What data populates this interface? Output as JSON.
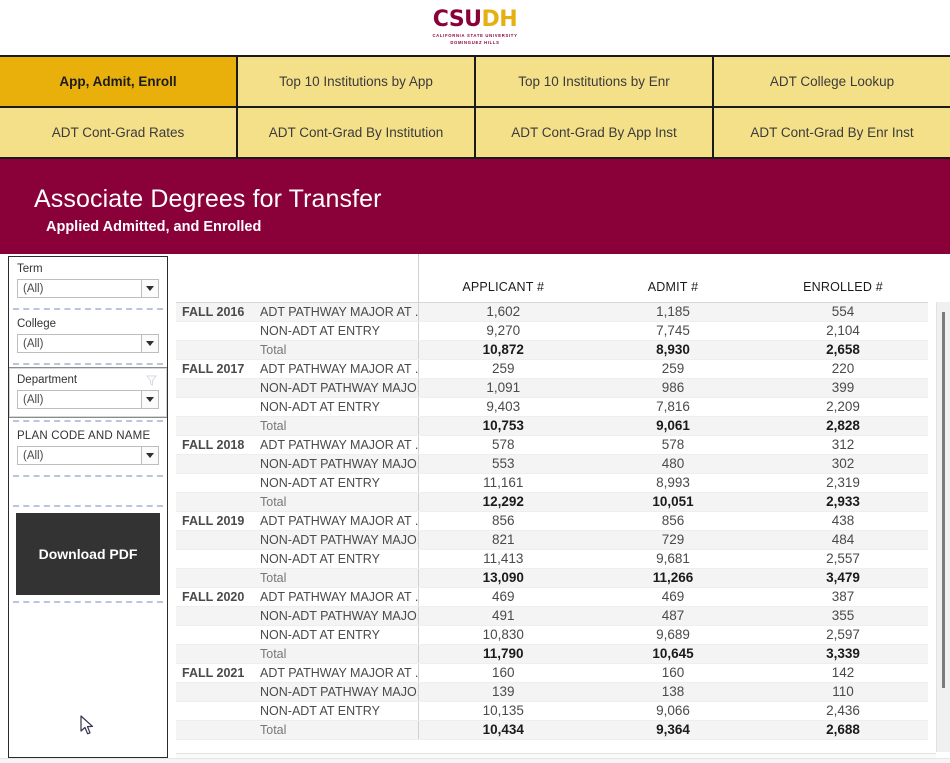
{
  "logo": {
    "mark_csu": "CSU",
    "mark_dh": "DH",
    "sub_line1": "CALIFORNIA STATE UNIVERSITY",
    "sub_line2": "DOMINGUEZ HILLS",
    "color_maroon": "#8A0038",
    "color_gold": "#E6B012"
  },
  "tabs": {
    "row1": [
      {
        "label": "App, Admit, Enroll",
        "active": true
      },
      {
        "label": "Top 10 Institutions by App",
        "active": false
      },
      {
        "label": "Top 10 Institutions by Enr",
        "active": false
      },
      {
        "label": "ADT College Lookup",
        "active": false
      }
    ],
    "row2": [
      {
        "label": "ADT Cont-Grad Rates",
        "active": false
      },
      {
        "label": "ADT Cont-Grad By Institution",
        "active": false
      },
      {
        "label": "ADT Cont-Grad By App Inst",
        "active": false
      },
      {
        "label": "ADT Cont-Grad By Enr Inst",
        "active": false
      }
    ],
    "active_color": "#E9B00C",
    "inactive_color": "#F5E08A"
  },
  "banner": {
    "title": "Associate Degrees for Transfer",
    "subtitle": "Applied Admitted, and Enrolled",
    "background": "#8A0038"
  },
  "sidebar": {
    "filters": [
      {
        "label": "Term",
        "value": "(All)",
        "has_funnel": false,
        "selected": false
      },
      {
        "label": "College",
        "value": "(All)",
        "has_funnel": false,
        "selected": false
      },
      {
        "label": "Department",
        "value": "(All)",
        "has_funnel": true,
        "selected": true
      },
      {
        "label": "PLAN CODE AND NAME",
        "value": "(All)",
        "has_funnel": false,
        "selected": false
      }
    ],
    "download_button": "Download PDF"
  },
  "table": {
    "columns": [
      "",
      "",
      "APPLICANT #",
      "ADMIT #",
      "ENROLLED #"
    ],
    "header_applicant": "APPLICANT #",
    "header_admit": "ADMIT #",
    "header_enrolled": "ENROLLED #",
    "rows": [
      {
        "year": "FALL 2016",
        "category": "ADT PATHWAY MAJOR AT ..",
        "applicant": "1,602",
        "admit": "1,185",
        "enrolled": "554",
        "total": false,
        "group_start": true
      },
      {
        "year": "",
        "category": "NON-ADT AT ENTRY",
        "applicant": "9,270",
        "admit": "7,745",
        "enrolled": "2,104",
        "total": false,
        "group_start": false
      },
      {
        "year": "",
        "category": "Total",
        "applicant": "10,872",
        "admit": "8,930",
        "enrolled": "2,658",
        "total": true,
        "group_start": false
      },
      {
        "year": "FALL 2017",
        "category": "ADT PATHWAY MAJOR AT ..",
        "applicant": "259",
        "admit": "259",
        "enrolled": "220",
        "total": false,
        "group_start": true
      },
      {
        "year": "",
        "category": "NON-ADT PATHWAY MAJO..",
        "applicant": "1,091",
        "admit": "986",
        "enrolled": "399",
        "total": false,
        "group_start": false
      },
      {
        "year": "",
        "category": "NON-ADT AT ENTRY",
        "applicant": "9,403",
        "admit": "7,816",
        "enrolled": "2,209",
        "total": false,
        "group_start": false
      },
      {
        "year": "",
        "category": "Total",
        "applicant": "10,753",
        "admit": "9,061",
        "enrolled": "2,828",
        "total": true,
        "group_start": false
      },
      {
        "year": "FALL 2018",
        "category": "ADT PATHWAY MAJOR AT ..",
        "applicant": "578",
        "admit": "578",
        "enrolled": "312",
        "total": false,
        "group_start": true
      },
      {
        "year": "",
        "category": "NON-ADT PATHWAY MAJO..",
        "applicant": "553",
        "admit": "480",
        "enrolled": "302",
        "total": false,
        "group_start": false
      },
      {
        "year": "",
        "category": "NON-ADT AT ENTRY",
        "applicant": "11,161",
        "admit": "8,993",
        "enrolled": "2,319",
        "total": false,
        "group_start": false
      },
      {
        "year": "",
        "category": "Total",
        "applicant": "12,292",
        "admit": "10,051",
        "enrolled": "2,933",
        "total": true,
        "group_start": false
      },
      {
        "year": "FALL 2019",
        "category": "ADT PATHWAY MAJOR AT ..",
        "applicant": "856",
        "admit": "856",
        "enrolled": "438",
        "total": false,
        "group_start": true
      },
      {
        "year": "",
        "category": "NON-ADT PATHWAY MAJO..",
        "applicant": "821",
        "admit": "729",
        "enrolled": "484",
        "total": false,
        "group_start": false
      },
      {
        "year": "",
        "category": "NON-ADT AT ENTRY",
        "applicant": "11,413",
        "admit": "9,681",
        "enrolled": "2,557",
        "total": false,
        "group_start": false
      },
      {
        "year": "",
        "category": "Total",
        "applicant": "13,090",
        "admit": "11,266",
        "enrolled": "3,479",
        "total": true,
        "group_start": false
      },
      {
        "year": "FALL 2020",
        "category": "ADT PATHWAY MAJOR AT ..",
        "applicant": "469",
        "admit": "469",
        "enrolled": "387",
        "total": false,
        "group_start": true
      },
      {
        "year": "",
        "category": "NON-ADT PATHWAY MAJO..",
        "applicant": "491",
        "admit": "487",
        "enrolled": "355",
        "total": false,
        "group_start": false
      },
      {
        "year": "",
        "category": "NON-ADT AT ENTRY",
        "applicant": "10,830",
        "admit": "9,689",
        "enrolled": "2,597",
        "total": false,
        "group_start": false
      },
      {
        "year": "",
        "category": "Total",
        "applicant": "11,790",
        "admit": "10,645",
        "enrolled": "3,339",
        "total": true,
        "group_start": false
      },
      {
        "year": "FALL 2021",
        "category": "ADT PATHWAY MAJOR AT ..",
        "applicant": "160",
        "admit": "160",
        "enrolled": "142",
        "total": false,
        "group_start": true
      },
      {
        "year": "",
        "category": "NON-ADT PATHWAY MAJO..",
        "applicant": "139",
        "admit": "138",
        "enrolled": "110",
        "total": false,
        "group_start": false
      },
      {
        "year": "",
        "category": "NON-ADT AT ENTRY",
        "applicant": "10,135",
        "admit": "9,066",
        "enrolled": "2,436",
        "total": false,
        "group_start": false
      },
      {
        "year": "",
        "category": "Total",
        "applicant": "10,434",
        "admit": "9,364",
        "enrolled": "2,688",
        "total": true,
        "group_start": false
      }
    ]
  }
}
